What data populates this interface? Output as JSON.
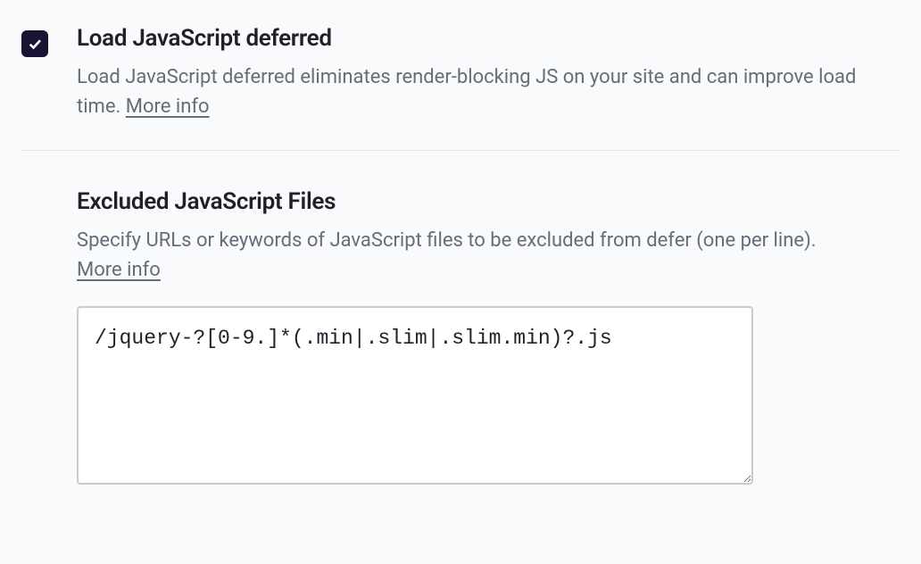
{
  "defer": {
    "title": "Load JavaScript deferred",
    "description_prefix": "Load JavaScript deferred eliminates render-blocking JS on your site and can improve load time. ",
    "more_info_label": "More info",
    "checked": true
  },
  "excluded": {
    "title": "Excluded JavaScript Files",
    "description_prefix": "Specify URLs or keywords of JavaScript files to be excluded from defer (one per line). ",
    "more_info_label": "More info",
    "textarea_value": "/jquery-?[0-9.]*(.min|.slim|.slim.min)?.js"
  }
}
